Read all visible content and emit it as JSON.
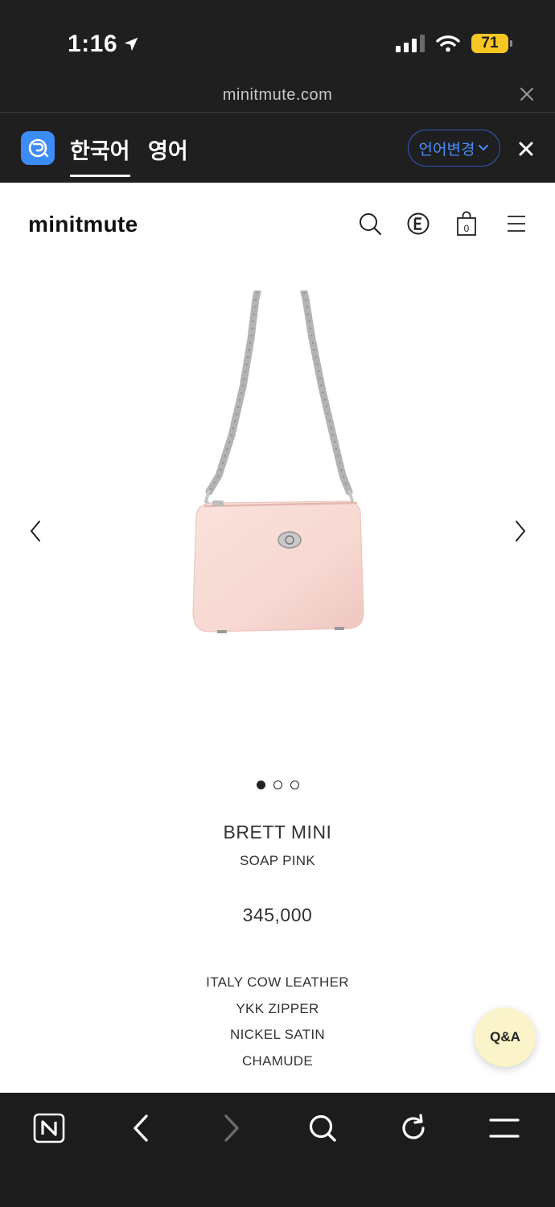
{
  "status_bar": {
    "time": "1:16",
    "battery": "71"
  },
  "browser": {
    "url": "minitmute.com"
  },
  "translate_bar": {
    "tabs": [
      "한국어",
      "영어"
    ],
    "active_tab": 0,
    "change_language_label": "언어변경"
  },
  "site": {
    "logo": "minitmute",
    "cart_count": "0"
  },
  "carousel": {
    "total_slides": 3,
    "active_slide": 1
  },
  "product": {
    "name": "BRETT MINI",
    "color": "SOAP PINK",
    "price": "345,000",
    "details": [
      "ITALY COW LEATHER",
      "YKK ZIPPER",
      "NICKEL SATIN",
      "CHAMUDE"
    ],
    "image_color": "#f7d8d2"
  },
  "qa_button": {
    "label": "Q&A",
    "color": "#fbf3c9"
  },
  "icons": [
    "location-arrow-icon",
    "signal-icon",
    "wifi-icon",
    "battery-icon",
    "close-icon",
    "papago-icon",
    "chevron-down-icon",
    "search-icon",
    "currency-e-icon",
    "shopping-bag-icon",
    "menu-icon",
    "chevron-left-icon",
    "chevron-right-icon",
    "naver-icon",
    "back-icon",
    "forward-icon",
    "reload-icon"
  ]
}
